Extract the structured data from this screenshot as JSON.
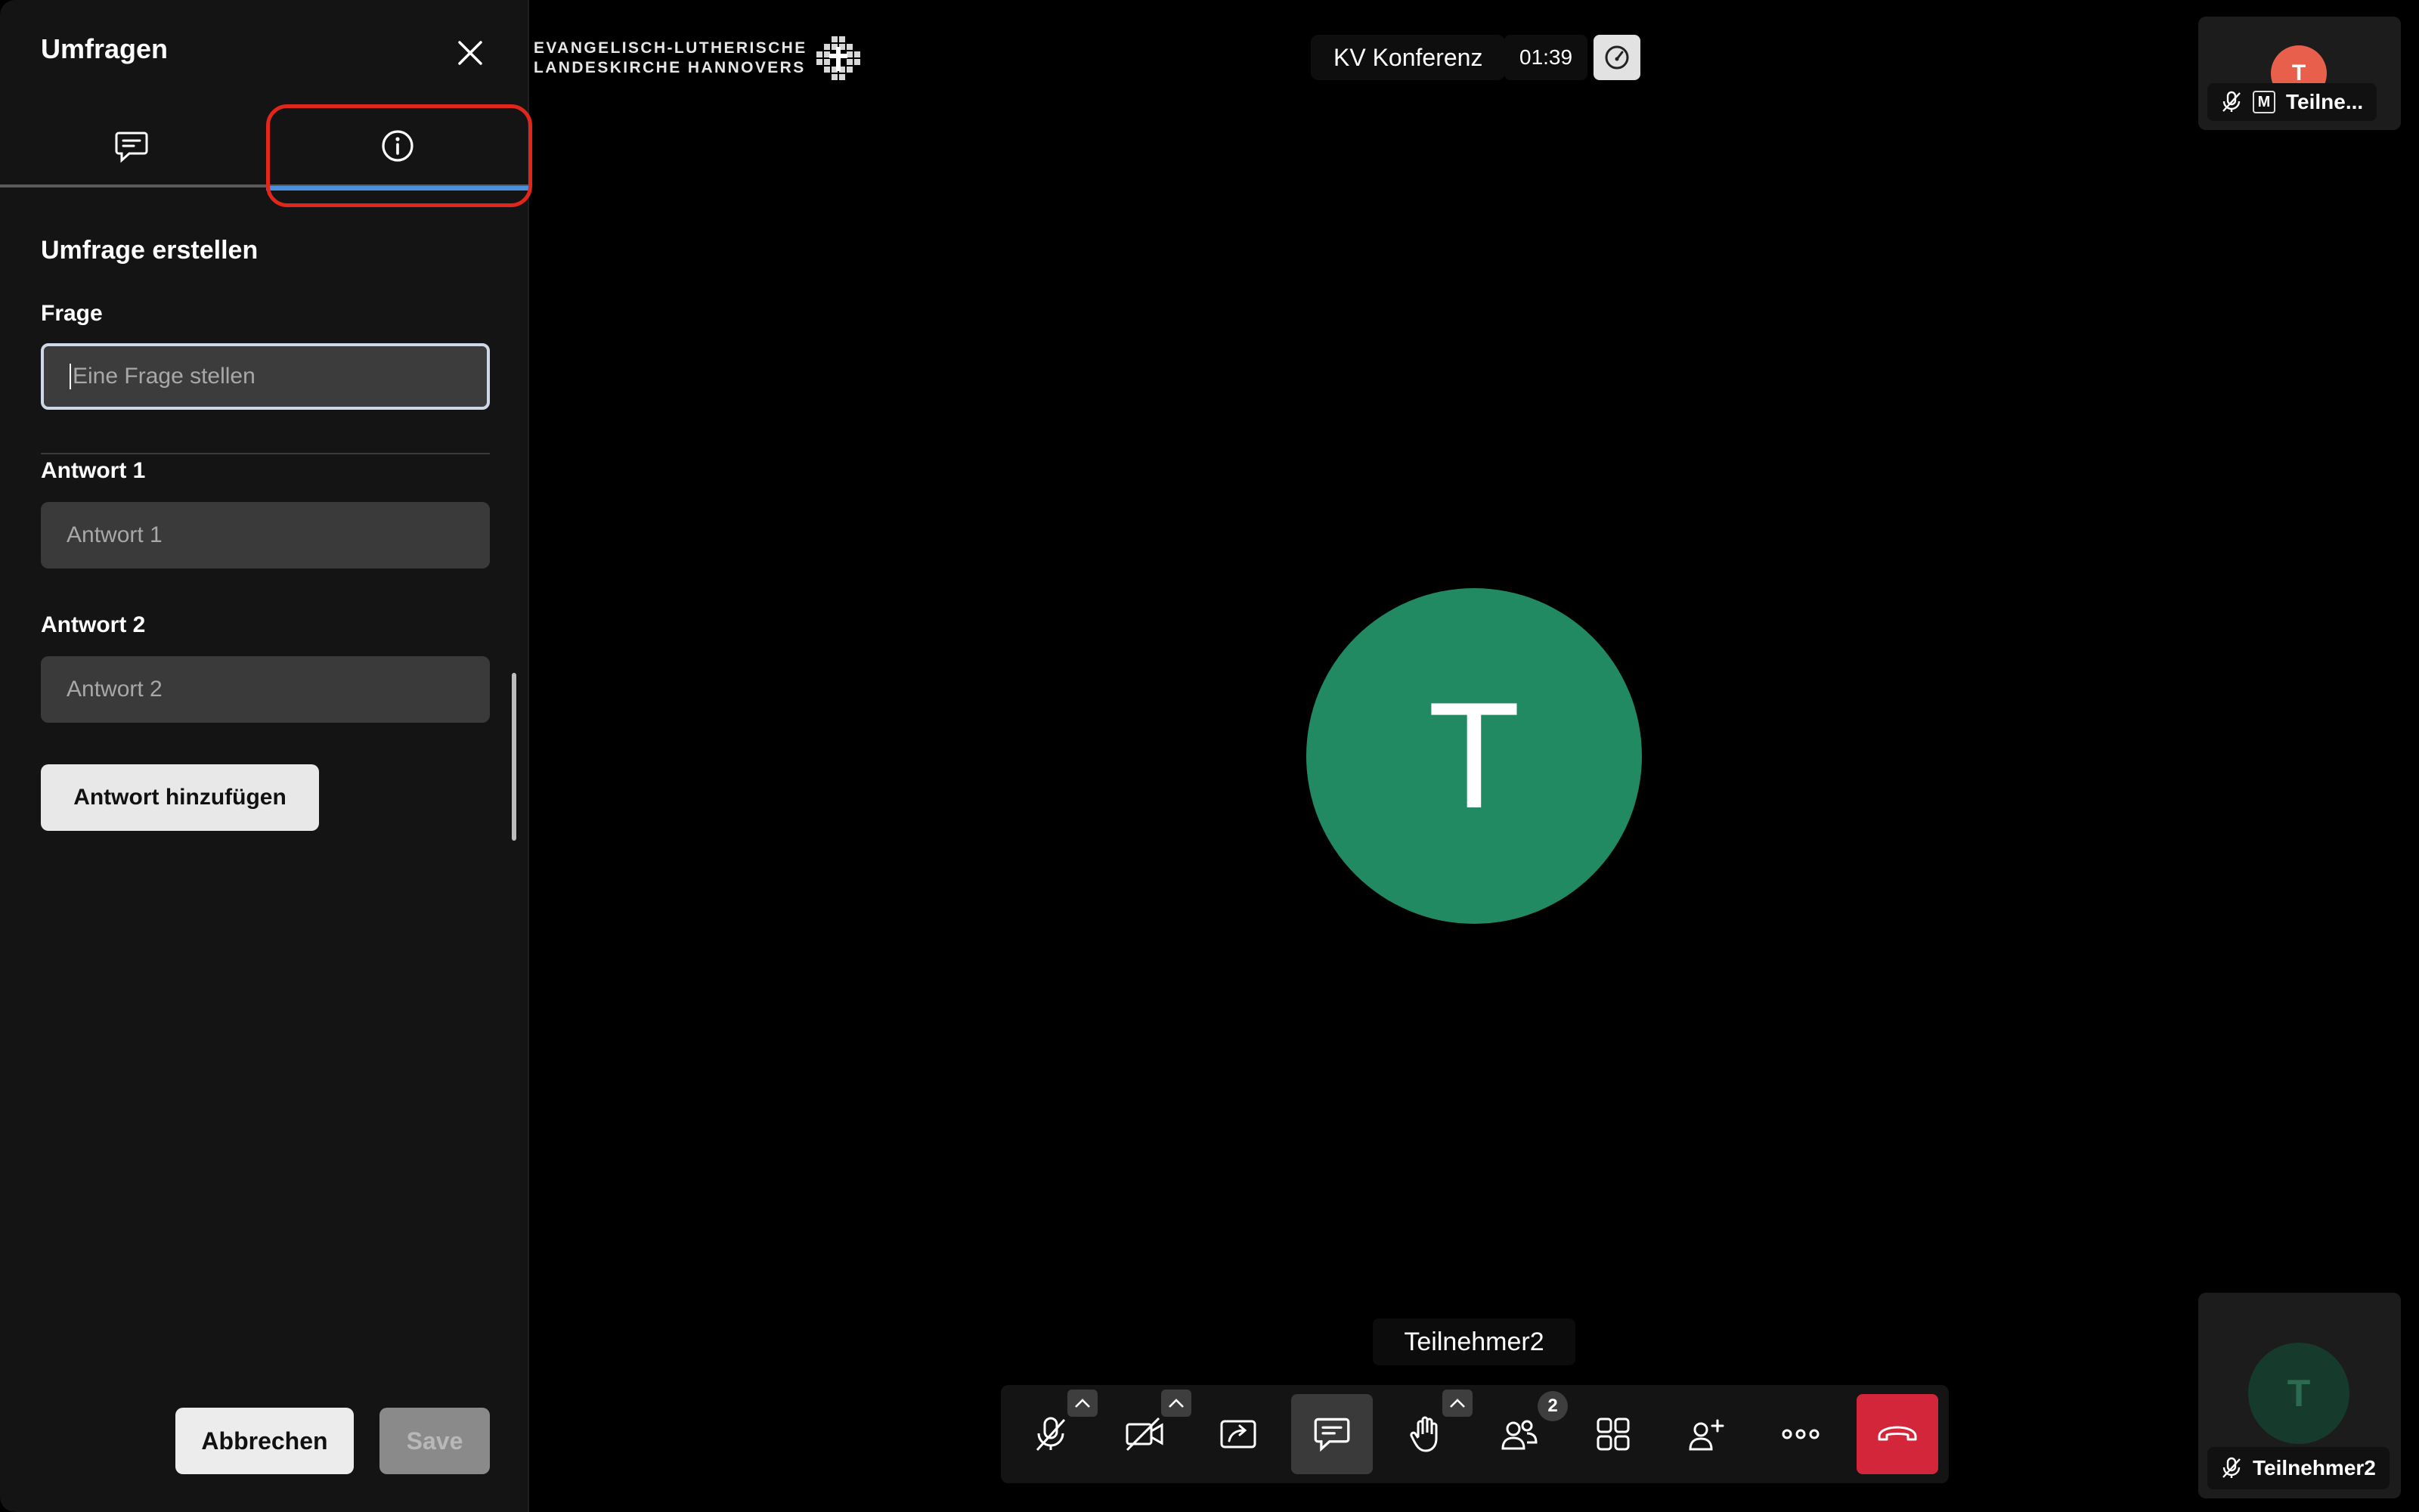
{
  "sidebar": {
    "title": "Umfragen",
    "tabs": [
      {
        "label": "chat",
        "icon": "chat-bubble-icon"
      },
      {
        "label": "info",
        "icon": "info-icon"
      }
    ],
    "section_title": "Umfrage erstellen",
    "question": {
      "label": "Frage",
      "placeholder": "Eine Frage stellen",
      "value": ""
    },
    "answers": [
      {
        "label": "Antwort 1",
        "placeholder": "Antwort 1"
      },
      {
        "label": "Antwort 2",
        "placeholder": "Antwort 2"
      }
    ],
    "add_answer_label": "Antwort hinzufügen",
    "cancel_label": "Abbrechen",
    "save_label": "Save"
  },
  "logo": {
    "line1": "EVANGELISCH-LUTHERISCHE",
    "line2": "LANDESKIRCHE HANNOVERS"
  },
  "header": {
    "conference_title": "KV Konferenz",
    "timer": "01:39"
  },
  "thumbnails": [
    {
      "initial": "T",
      "name": "Teilne...",
      "avatar_color": "#e8604c",
      "moderator_mark": "M"
    },
    {
      "initial": "T",
      "name": "Teilnehmer2",
      "avatar_color": "#163a2c"
    }
  ],
  "main": {
    "initial": "T",
    "name": "Teilnehmer2",
    "avatar_color": "#228a63"
  },
  "toolbar": {
    "participant_count": "2",
    "buttons": [
      "microphone-muted",
      "camera-off",
      "screen-share",
      "chat",
      "raise-hand",
      "participants",
      "tile-view",
      "invite",
      "more",
      "hangup"
    ]
  },
  "colors": {
    "accent": "#4a8fe0",
    "highlight": "#e1261c",
    "hangup": "#d3263a",
    "avatar_main": "#228a63"
  }
}
